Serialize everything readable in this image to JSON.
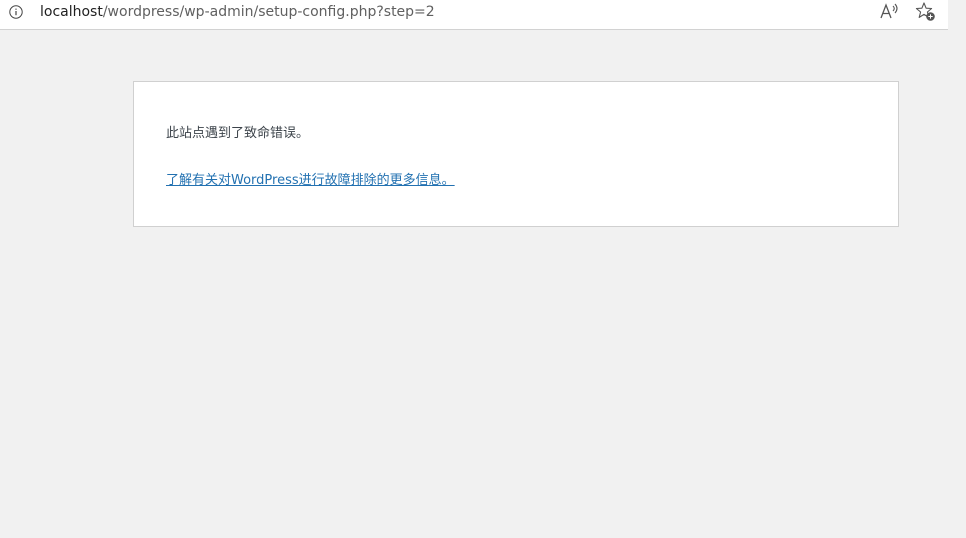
{
  "address_bar": {
    "host": "localhost",
    "path": "/wordpress/wp-admin/setup-config.php?step=2",
    "info_icon": "info-icon",
    "read_aloud_icon": "read-aloud-icon",
    "favorite_icon": "add-favorite-icon"
  },
  "error_page": {
    "message": "此站点遇到了致命错误。",
    "help_link": "了解有关对WordPress进行故障排除的更多信息。"
  },
  "colors": {
    "page_background": "#f1f1f1",
    "link": "#2271b1",
    "text": "#3c434a"
  }
}
